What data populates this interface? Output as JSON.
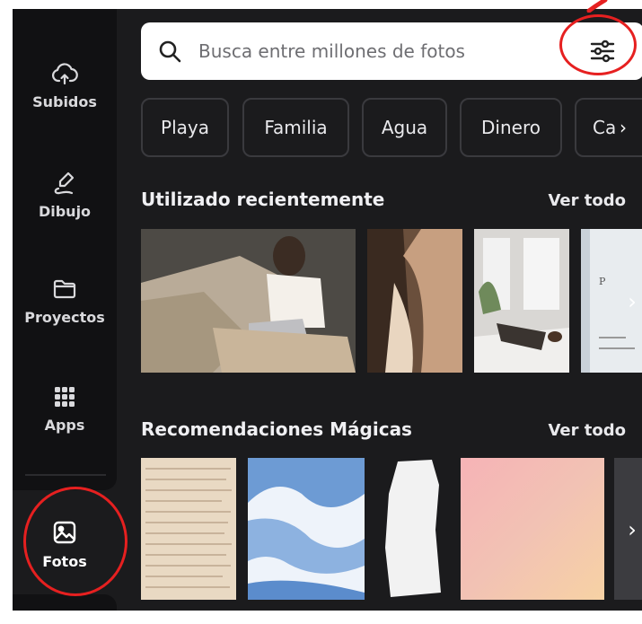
{
  "sidebar": {
    "items": [
      {
        "label": "Subidos",
        "icon": "cloud-upload-icon"
      },
      {
        "label": "Dibujo",
        "icon": "draw-icon"
      },
      {
        "label": "Proyectos",
        "icon": "folder-icon"
      },
      {
        "label": "Apps",
        "icon": "apps-grid-icon"
      }
    ],
    "active": {
      "label": "Fotos",
      "icon": "photo-icon"
    }
  },
  "search": {
    "placeholder": "Busca entre millones de fotos",
    "value": ""
  },
  "chips": [
    "Playa",
    "Familia",
    "Agua",
    "Dinero",
    "Ca"
  ],
  "sections": {
    "recent": {
      "title": "Utilizado recientemente",
      "see_all": "Ver todo"
    },
    "magic": {
      "title": "Recomendaciones Mágicas",
      "see_all": "Ver todo"
    }
  },
  "colors": {
    "background": "#1b1b1d",
    "sidebar": "#111113",
    "annotation": "#e62020"
  }
}
